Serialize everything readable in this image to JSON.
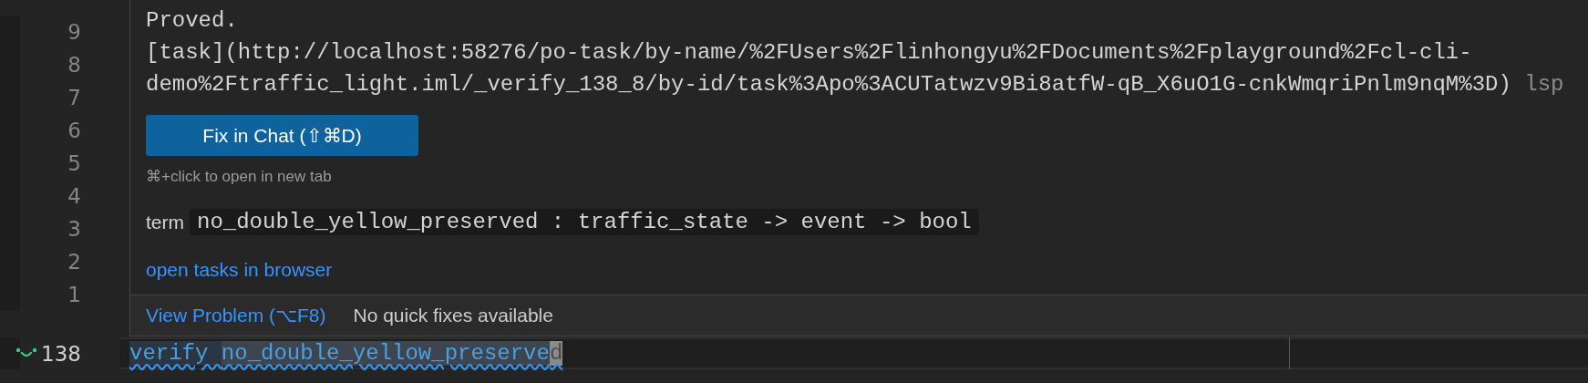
{
  "gutter": [
    {
      "number": "9",
      "current": false
    },
    {
      "number": "8",
      "current": false
    },
    {
      "number": "7",
      "current": false
    },
    {
      "number": "6",
      "current": false
    },
    {
      "number": "5",
      "current": false
    },
    {
      "number": "4",
      "current": false
    },
    {
      "number": "3",
      "current": false
    },
    {
      "number": "2",
      "current": false
    },
    {
      "number": "1",
      "current": false
    },
    {
      "number": "138",
      "current": true
    }
  ],
  "code_line": [
    {
      "kind": "plain",
      "text": "verify "
    },
    {
      "kind": "selected",
      "text": "no_double_yellow_preserve"
    },
    {
      "kind": "cursor",
      "text": "d"
    }
  ],
  "hover": {
    "status": "Proved.",
    "link_text": "[task](http://localhost:58276/po-task/by-name/%2FUsers%2Flinhongyu%2FDocuments%2Fplayground%2Fcl-cli-demo%2Ftraffic_light.iml/_verify_138_8/by-id/task%3Apo%3ACUTatwzv9Bi8atfW-qB_X6uO1G-cnkWmqriPnlm9nqM%3D)",
    "source": "lsp",
    "button": "Fix in Chat (⇧⌘D)",
    "hint": "⌘+click to open in new tab",
    "term_label": "term",
    "term_signature": "no_double_yellow_preserved : traffic_state -> event -> bool",
    "browser_link": "open tasks in browser"
  },
  "status_bar": {
    "view_problem": "View Problem (⌥F8)",
    "quick_fixes": "No quick fixes available"
  }
}
